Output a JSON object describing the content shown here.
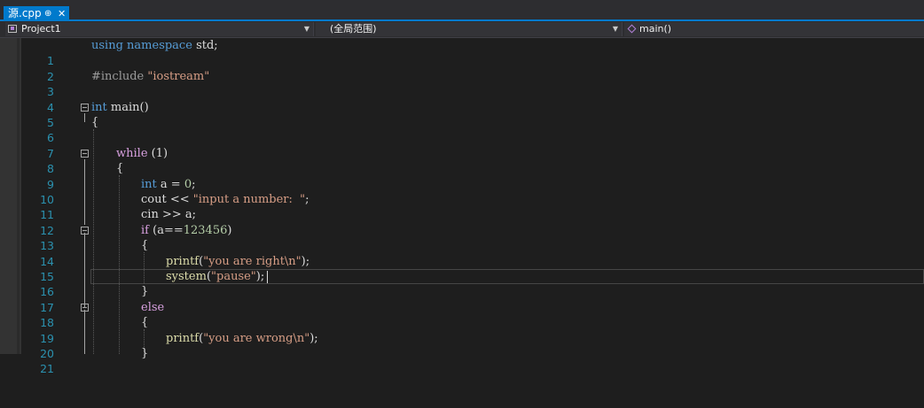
{
  "tab": {
    "title": "源.cpp",
    "pin": "⊕",
    "close": "✕"
  },
  "nav": {
    "project": "Project1",
    "scope": "(全局范围)",
    "function": "main()"
  },
  "colors": {
    "accent": "#007acc",
    "line_numbers": "#2b91af",
    "keyword": "#569cd6",
    "control": "#d8a0df",
    "string": "#d69d85"
  },
  "code_lines": [
    {
      "num": "1",
      "text": "using namespace std;"
    },
    {
      "num": "2",
      "text": ""
    },
    {
      "num": "3",
      "text": "#include \"iostream\""
    },
    {
      "num": "4",
      "text": ""
    },
    {
      "num": "5",
      "text": "int main()"
    },
    {
      "num": "6",
      "text": "{"
    },
    {
      "num": "7",
      "text": ""
    },
    {
      "num": "8",
      "text": "while (1)"
    },
    {
      "num": "9",
      "text": "{"
    },
    {
      "num": "10",
      "text": "int a = 0;"
    },
    {
      "num": "11",
      "text": "cout << \"input a number:  \";"
    },
    {
      "num": "12",
      "text": "cin >> a;"
    },
    {
      "num": "13",
      "text": "if (a==123456)"
    },
    {
      "num": "14",
      "text": "{"
    },
    {
      "num": "15",
      "text": "printf(\"you are right\\n\");"
    },
    {
      "num": "16",
      "text": "system(\"pause\");"
    },
    {
      "num": "17",
      "text": "}"
    },
    {
      "num": "18",
      "text": "else"
    },
    {
      "num": "19",
      "text": "{"
    },
    {
      "num": "20",
      "text": "printf(\"you are wrong\\n\");"
    },
    {
      "num": "21",
      "text": "}"
    }
  ],
  "tokens": {
    "l1": [
      "using",
      "namespace",
      "std",
      ";"
    ],
    "l3": [
      "#include",
      "\"iostream\""
    ],
    "l5": [
      "int",
      "main()"
    ],
    "l6": [
      "{"
    ],
    "l8": [
      "while",
      " (1)"
    ],
    "l9": [
      "{"
    ],
    "l10": [
      "int",
      " a = ",
      "0",
      ";"
    ],
    "l11": [
      "cout << ",
      "\"input a number:  \"",
      ";"
    ],
    "l12": [
      "cin >> a;"
    ],
    "l13": [
      "if",
      " (a==",
      "123456",
      ")"
    ],
    "l14": [
      "{"
    ],
    "l15": [
      "printf",
      "(",
      "\"you are right\\n\"",
      ");"
    ],
    "l16": [
      "system",
      "(",
      "\"pause\"",
      ");"
    ],
    "l17": [
      "}"
    ],
    "l18": [
      "else"
    ],
    "l19": [
      "{"
    ],
    "l20": [
      "printf",
      "(",
      "\"you are wrong\\n\"",
      ");"
    ],
    "l21": [
      "}"
    ]
  }
}
